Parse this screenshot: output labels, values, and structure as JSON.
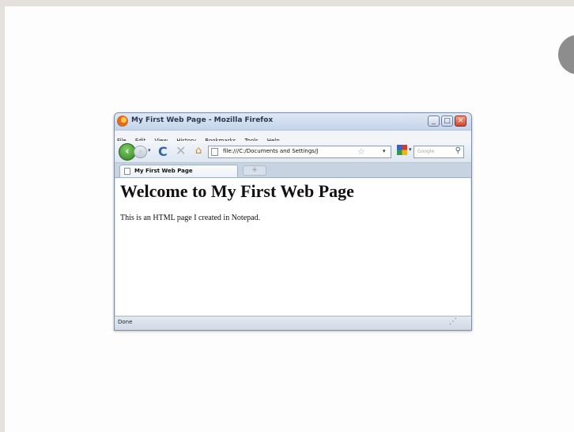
{
  "browser": {
    "title": "My First Web Page - Mozilla Firefox",
    "menu": [
      "File",
      "Edit",
      "View",
      "History",
      "Bookmarks",
      "Tools",
      "Help"
    ],
    "url": "file:///C:/Documents and Settings/J",
    "search_placeholder": "Google",
    "tab_label": "My First Web Page",
    "new_tab_label": "+",
    "status": "Done",
    "window_controls": {
      "minimize": "_",
      "maximize": "□",
      "close": "✕"
    }
  },
  "page": {
    "heading": "Welcome to My First Web Page",
    "paragraph": "This is an HTML page I created in Notepad."
  },
  "icons": {
    "back": "‹",
    "forward": "›",
    "dropdown": "▾",
    "reload": "C",
    "stop": "✕",
    "home": "⌂",
    "star": "☆",
    "search": "⚲",
    "grip": "⋰"
  }
}
